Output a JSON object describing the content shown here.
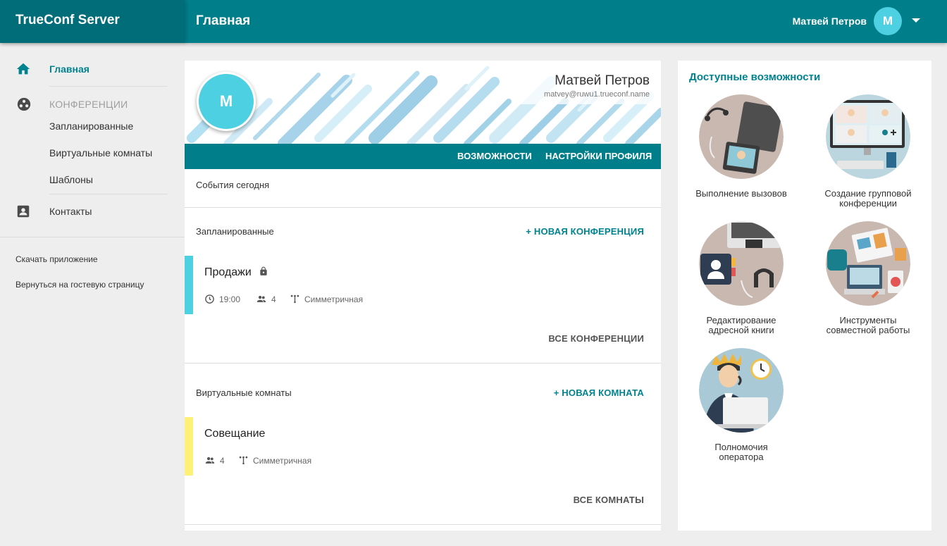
{
  "app": {
    "brand": "TrueConf Server",
    "page_title": "Главная",
    "user_name": "Матвей Петров",
    "user_initial": "M"
  },
  "sidebar": {
    "home_label": "Главная",
    "section_label": "КОНФЕРЕНЦИИ",
    "sub_items": [
      "Запланированные",
      "Виртуальные комнаты",
      "Шаблоны"
    ],
    "contacts_label": "Контакты",
    "download_link": "Скачать приложение",
    "guest_link": "Вернуться на гостевую страницу"
  },
  "profile": {
    "initial": "M",
    "name": "Матвей Петров",
    "email": "matvey@ruwu1.trueconf.name",
    "tabs": [
      "ВОЗМОЖНОСТИ",
      "НАСТРОЙКИ ПРОФИЛЯ"
    ]
  },
  "events_today": "События сегодня",
  "scheduled": {
    "title": "Запланированные",
    "action": "+ НОВАЯ КОНФЕРЕНЦИЯ",
    "card": {
      "name": "Продажи",
      "time": "19:00",
      "participants": "4",
      "mode": "Симметричная",
      "stripe_color": "#4dd0e1"
    },
    "footer": "ВСЕ КОНФЕРЕНЦИИ"
  },
  "rooms": {
    "title": "Виртуальные комнаты",
    "action": "+ НОВАЯ КОМНАТА",
    "card": {
      "name": "Совещание",
      "participants": "4",
      "mode": "Симметричная",
      "stripe_color": "#fff176"
    },
    "footer": "ВСЕ КОМНАТЫ"
  },
  "features": {
    "title": "Доступные возможности",
    "items": [
      {
        "line1": "Выполнение вызовов",
        "line2": ""
      },
      {
        "line1": "Создание групповой",
        "line2": "конференции"
      },
      {
        "line1": "Редактирование",
        "line2": "адресной книги"
      },
      {
        "line1": "Инструменты",
        "line2": "совместной работы"
      },
      {
        "line1": "Полномочия",
        "line2": "оператора"
      }
    ]
  },
  "colors": {
    "accent": "#007f8b",
    "accent_dark": "#006d78",
    "avatar": "#4dd0e1",
    "link": "#00838f"
  }
}
